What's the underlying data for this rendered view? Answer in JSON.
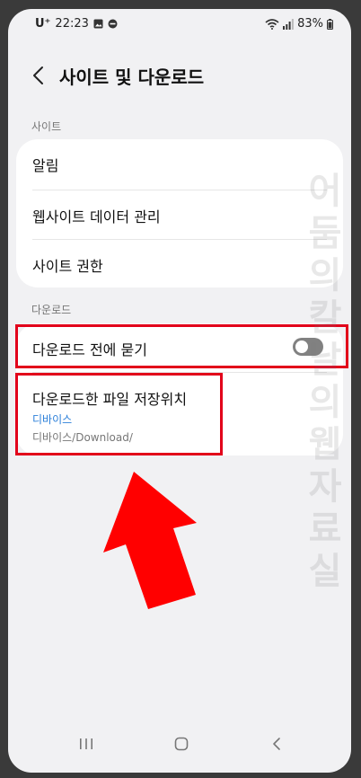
{
  "status_bar": {
    "carrier": "U⁺",
    "time": "22:23",
    "battery": "83%"
  },
  "header": {
    "title": "사이트 및 다운로드"
  },
  "sections": {
    "site": {
      "label": "사이트",
      "items": [
        "알림",
        "웹사이트 데이터 관리",
        "사이트 권한"
      ]
    },
    "download": {
      "label": "다운로드",
      "ask_before": {
        "label": "다운로드 전에 묻기",
        "enabled": false
      },
      "save_location": {
        "label": "다운로드한 파일 저장위치",
        "value": "디바이스",
        "path": "디바이스/Download/"
      }
    }
  },
  "watermark": "어둠의칼날의웹자료실",
  "colors": {
    "highlight": "#e2001a",
    "arrow": "#ff0000",
    "accent_blue": "#2b7fd9",
    "toggle_off": "#818181"
  }
}
